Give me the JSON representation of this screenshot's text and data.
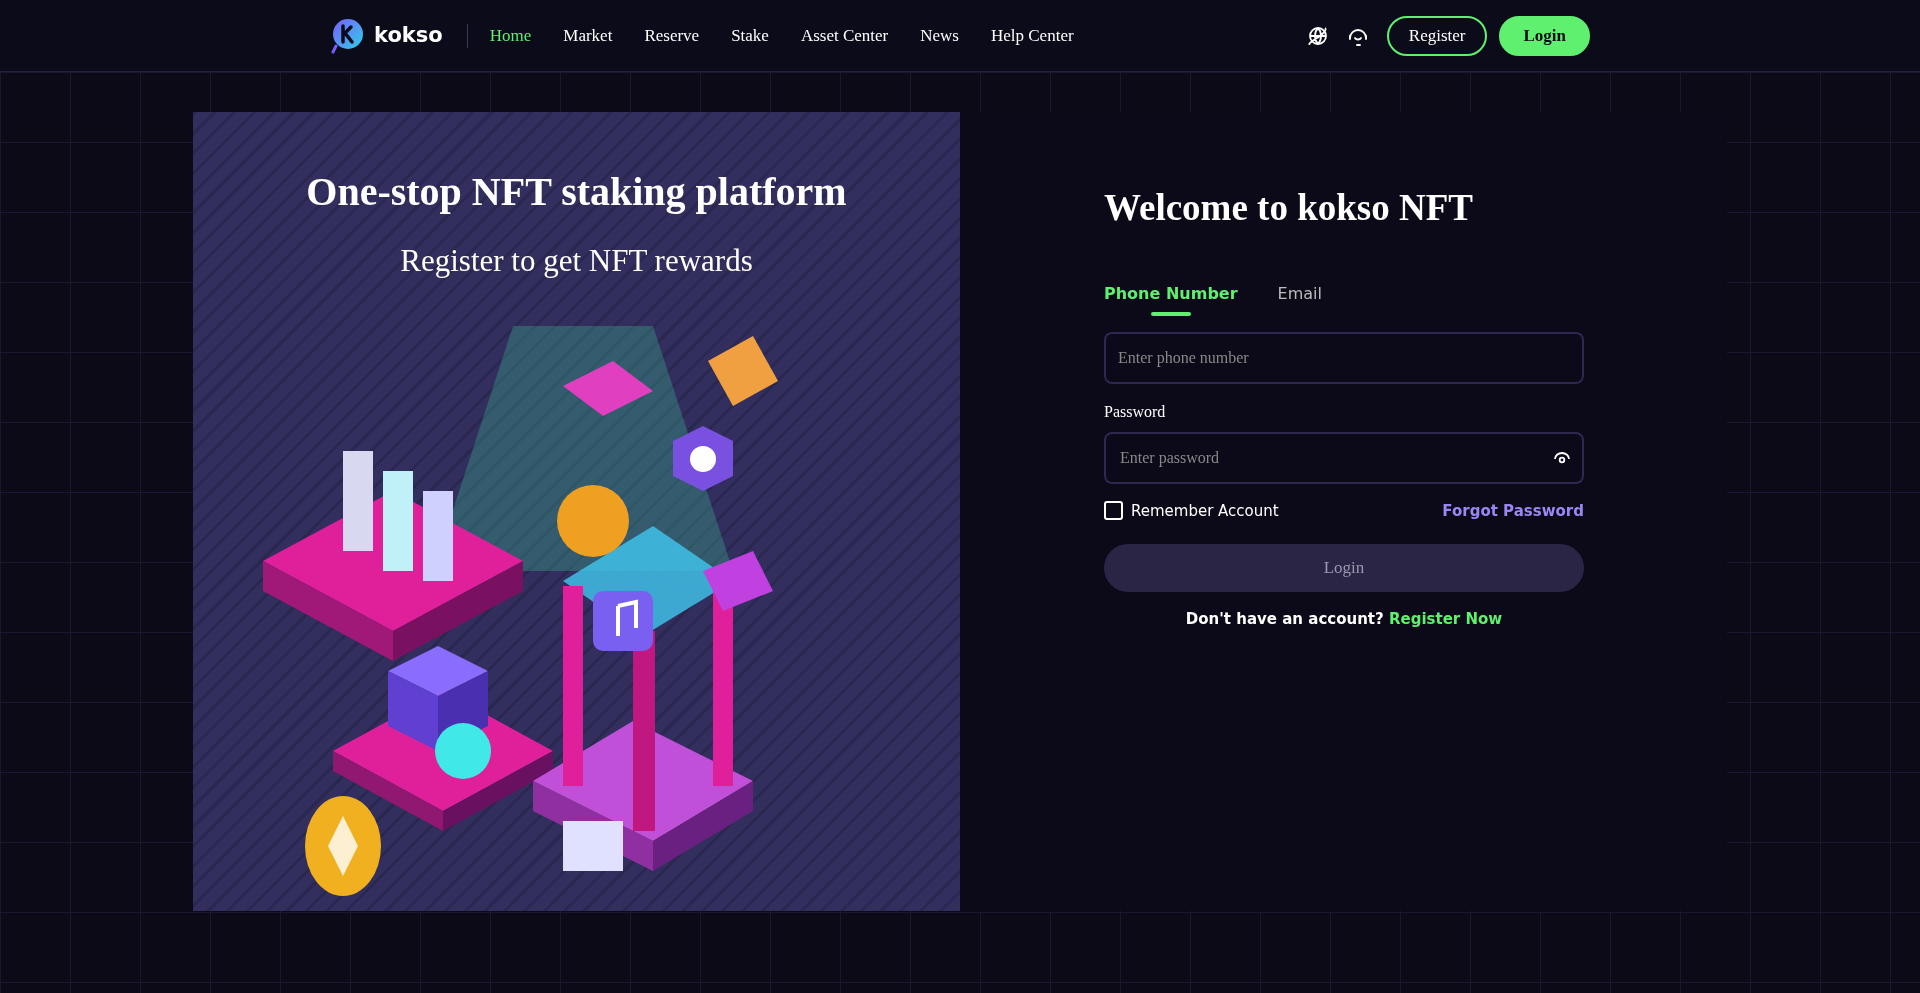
{
  "header": {
    "logo_text": "kokso",
    "nav": [
      {
        "label": "Home",
        "selected": true
      },
      {
        "label": "Market",
        "selected": false
      },
      {
        "label": "Reserve",
        "selected": false
      },
      {
        "label": "Stake",
        "selected": false
      },
      {
        "label": "Asset Center",
        "selected": false
      },
      {
        "label": "News",
        "selected": false
      },
      {
        "label": "Help Center",
        "selected": false
      }
    ],
    "buttons": [
      {
        "label": "Register",
        "kind": "outline"
      },
      {
        "label": "Login",
        "kind": "solid"
      }
    ]
  },
  "promo": {
    "title": "One-stop NFT staking platform",
    "subtitle": "Register to get NFT rewards"
  },
  "form": {
    "title": "Welcome to kokso NFT",
    "tabs": [
      {
        "label": "Phone Number",
        "selected": true
      },
      {
        "label": "Email",
        "selected": false
      }
    ],
    "phone": {
      "placeholder": "Enter phone number"
    },
    "password_label": "Password",
    "password": {
      "placeholder": "Enter password"
    },
    "remember": {
      "label": "Remember Account",
      "checked": false
    },
    "forgot": "Forgot Password",
    "submit": {
      "label": "Login",
      "disabled": true
    },
    "signup": {
      "text": "Don't have an account?",
      "link": "Register Now"
    }
  }
}
